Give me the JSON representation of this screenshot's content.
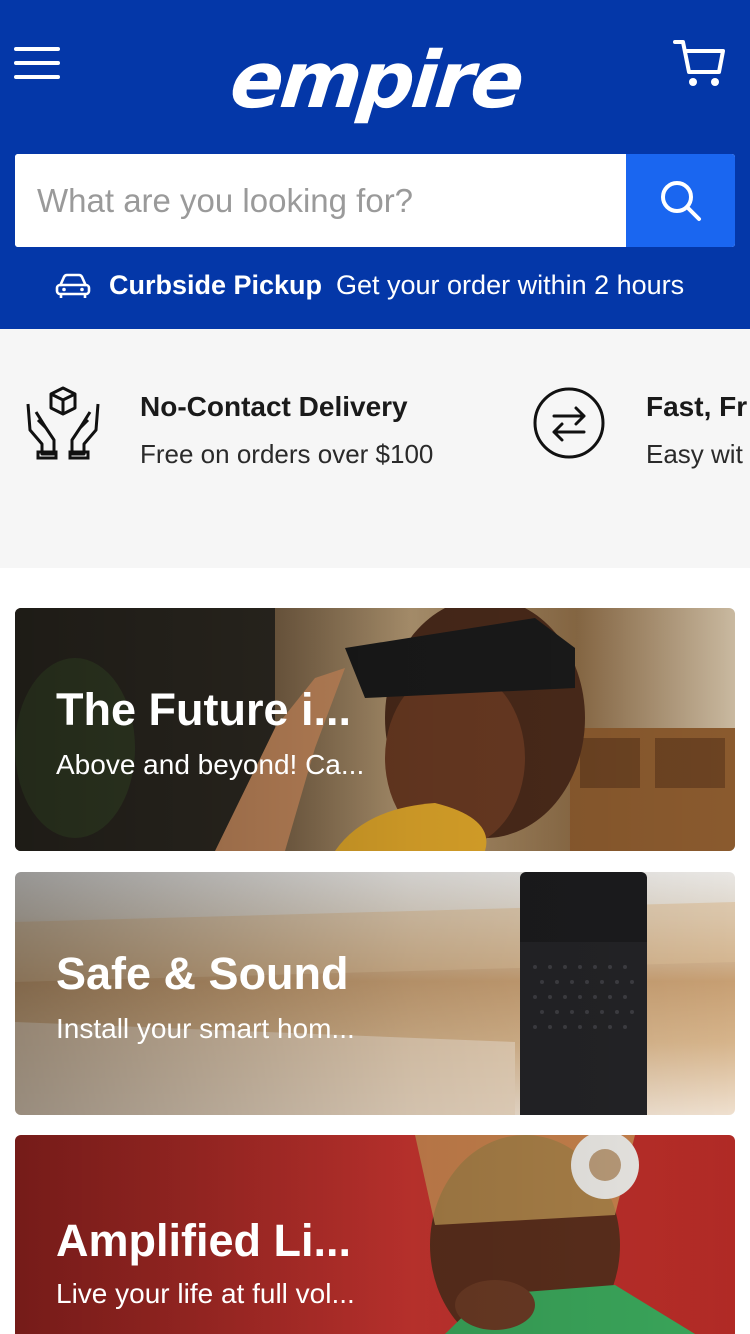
{
  "header": {
    "logo_text": "empire",
    "menu_icon": "hamburger-menu-icon",
    "cart_icon": "cart-icon",
    "background_color": "#0437a8"
  },
  "search": {
    "placeholder": "What are you looking for?",
    "value": "",
    "button_icon": "search-icon",
    "button_color": "#1a66f0"
  },
  "curbside": {
    "icon": "car-icon",
    "title": "Curbside Pickup",
    "subtitle": "Get your order within 2 hours"
  },
  "features": [
    {
      "icon": "hands-box-icon",
      "title": "No-Contact Delivery",
      "subtitle": "Free on orders over $100"
    },
    {
      "icon": "exchange-arrows-icon",
      "title": "Fast, Fr",
      "subtitle": "Easy wit"
    }
  ],
  "promos": [
    {
      "title": "The Future i...",
      "subtitle": "Above and beyond! Ca..."
    },
    {
      "title": "Safe & Sound",
      "subtitle": "Install your smart hom..."
    },
    {
      "title": "Amplified Li...",
      "subtitle": "Live your life at full vol..."
    }
  ]
}
